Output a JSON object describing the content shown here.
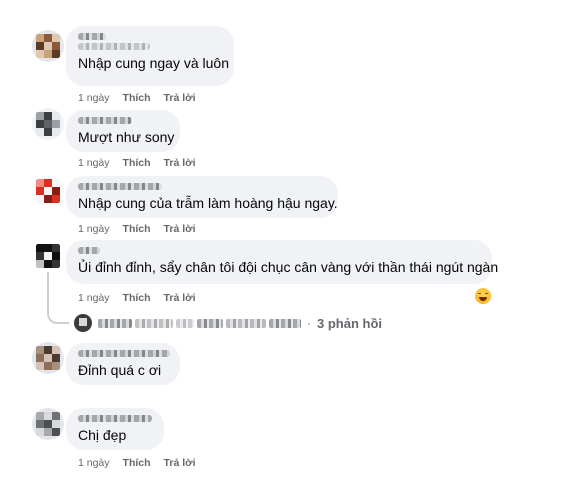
{
  "actions": {
    "time": "1 ngày",
    "like": "Thích",
    "reply": "Trả lời"
  },
  "comments": [
    {
      "text": "Nhập cung ngay và luôn",
      "avatar_colors": [
        "#c9a27a",
        "#8a5a3a",
        "#e0c9ae",
        "#5b3b28"
      ]
    },
    {
      "text": "Mượt như sony",
      "avatar_colors": [
        "#9aa0a6",
        "#3b3f44",
        "#e9eaeb",
        "#5f6368"
      ]
    },
    {
      "text": "Nhập cung của trẫm làm hoàng hậu ngay.",
      "avatar_colors": [
        "#d93025",
        "#f5f5f5",
        "#8b1c14",
        "#f28b82"
      ]
    },
    {
      "text": "Ủi đỉnh đỉnh, sẩy chân tôi đội chục cân vàng với thần thái ngút ngàn",
      "avatar_colors": [
        "#111111",
        "#f2f2f2",
        "#333333",
        "#c0c0c0"
      ]
    },
    {
      "text": "Đỉnh quá c ơi",
      "avatar_colors": [
        "#8c6e5a",
        "#d3c2b5",
        "#4a3a30",
        "#a6917f"
      ]
    },
    {
      "text": "Chị đẹp",
      "avatar_colors": [
        "#a7a9ac",
        "#6f7275",
        "#d9dadb",
        "#4b4e52"
      ]
    }
  ],
  "replies": {
    "count_label": "3 phản hồi",
    "separator": "·"
  },
  "emoji": "grinning-squinting-face-icon"
}
